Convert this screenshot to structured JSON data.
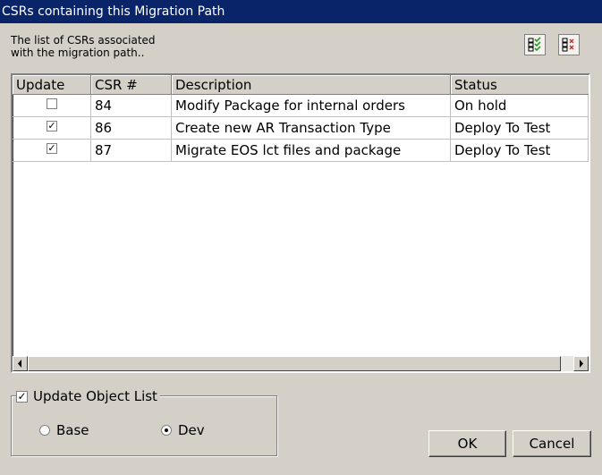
{
  "window": {
    "title": "CSRs containing this Migration Path"
  },
  "intro": {
    "line1": "The list of CSRs associated",
    "line2": "with the migration path.."
  },
  "toolbar": {
    "select_all_icon": "check-all-icon",
    "deselect_all_icon": "uncheck-all-icon"
  },
  "table": {
    "headers": {
      "update": "Update",
      "csr": "CSR #",
      "description": "Description",
      "status": "Status"
    },
    "rows": [
      {
        "checked": false,
        "check_mark": "",
        "csr": "84",
        "description": "Modify Package for internal orders",
        "status": "On hold"
      },
      {
        "checked": true,
        "check_mark": "✓",
        "csr": "86",
        "description": "Create new AR Transaction Type",
        "status": "Deploy To Test"
      },
      {
        "checked": true,
        "check_mark": "✓",
        "csr": "87",
        "description": "Migrate EOS lct files and package",
        "status": "Deploy To Test"
      }
    ]
  },
  "options": {
    "update_object_list": {
      "label": "Update Object List",
      "checked": true,
      "check_mark": "✓"
    },
    "radios": [
      {
        "label": "Base",
        "selected": false
      },
      {
        "label": "Dev",
        "selected": true
      }
    ]
  },
  "buttons": {
    "ok": "OK",
    "cancel": "Cancel"
  },
  "colors": {
    "titlebar": "#0a246a",
    "face": "#d4d0c8"
  }
}
